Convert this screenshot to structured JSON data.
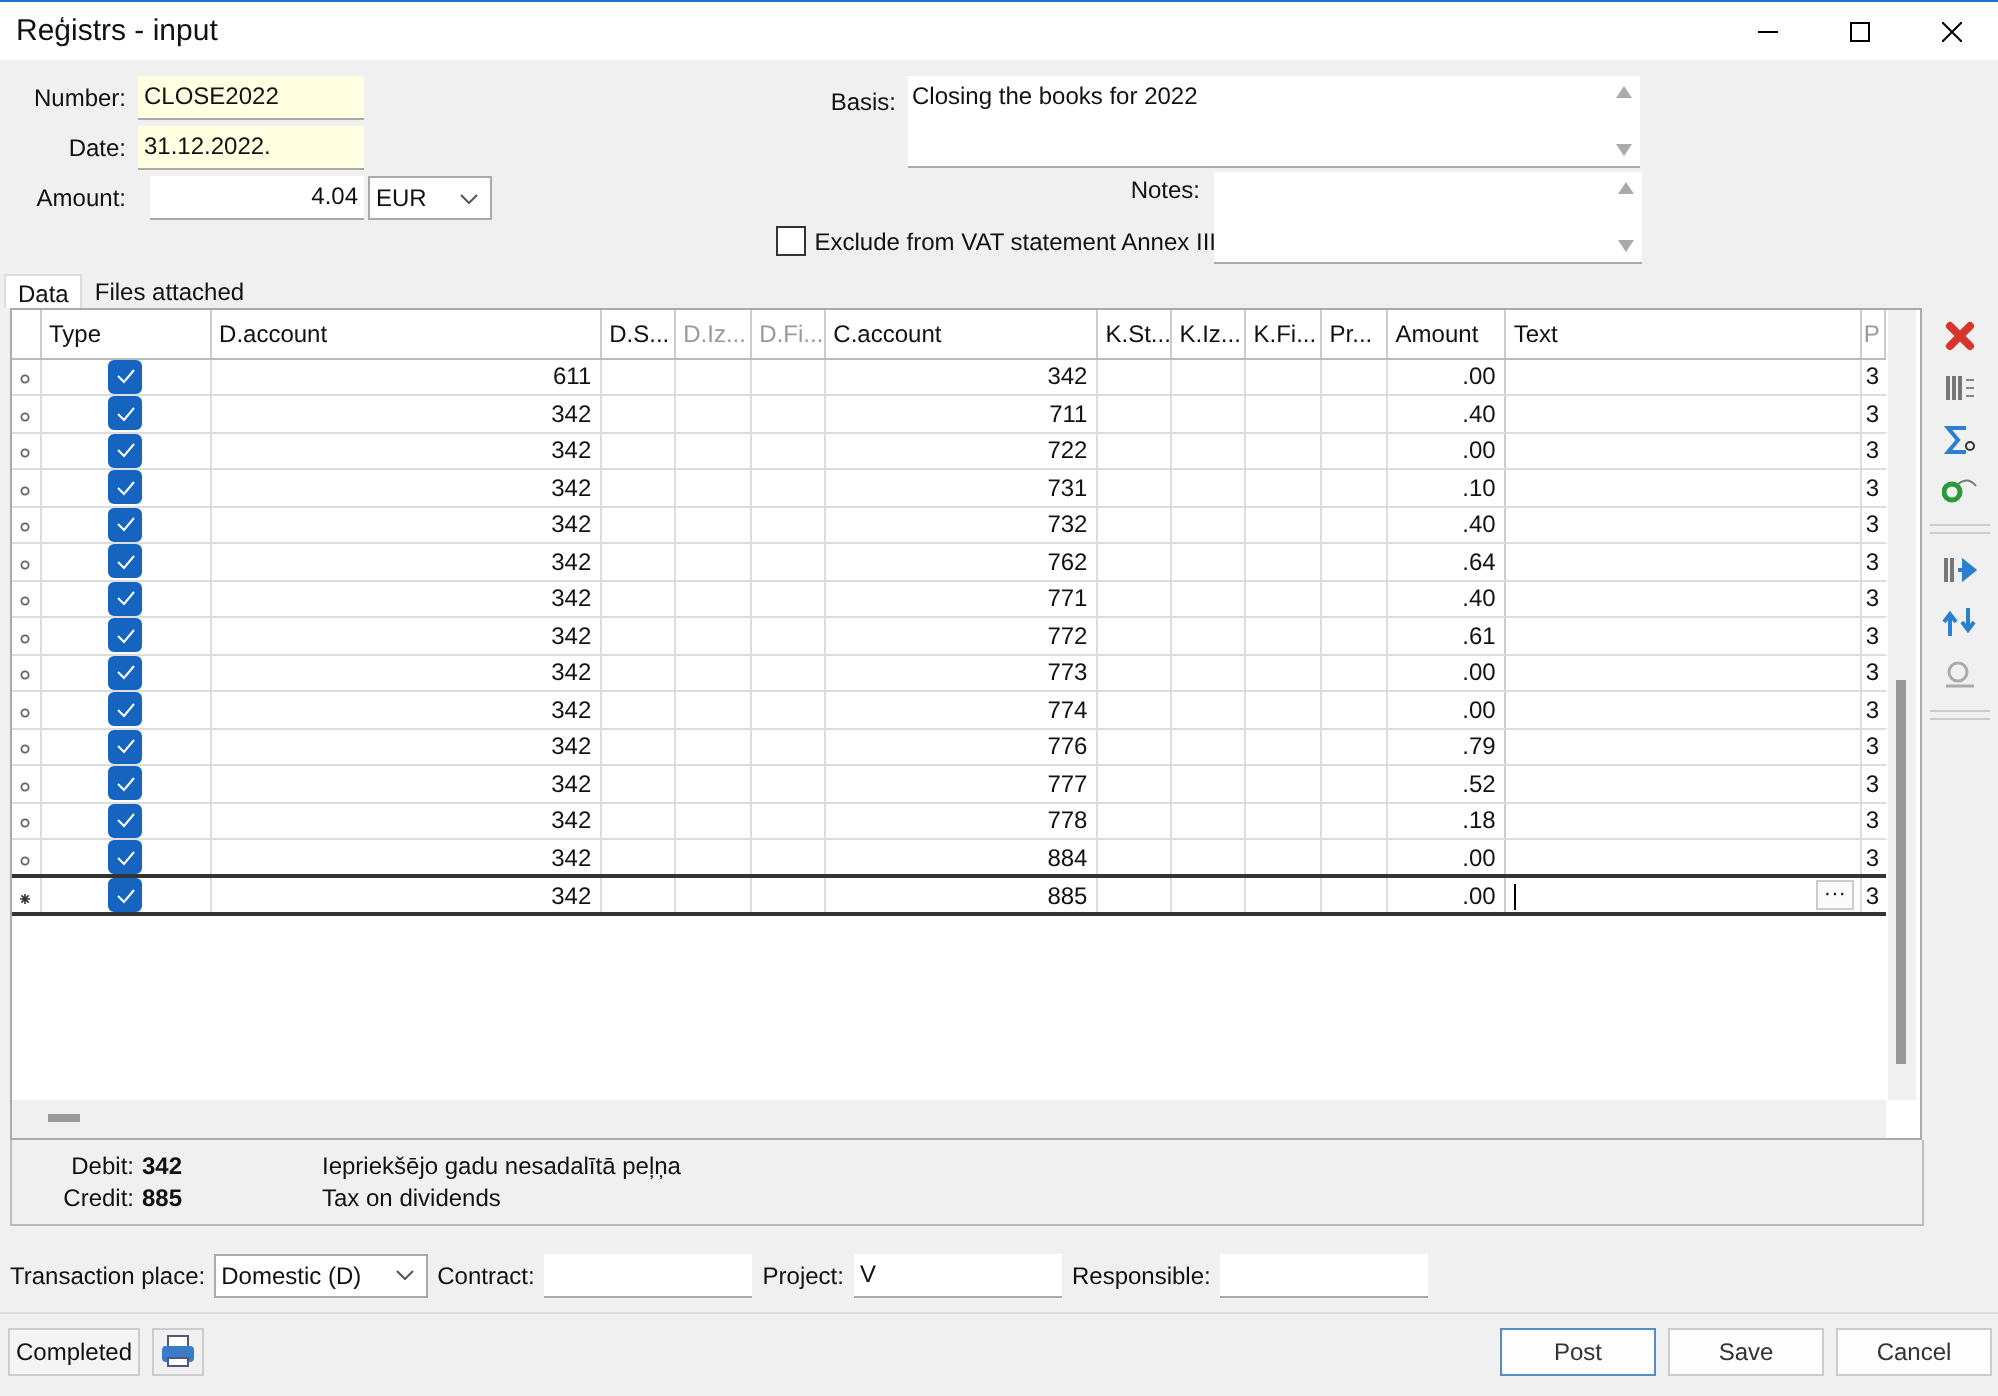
{
  "window": {
    "title": "Reģistrs - input"
  },
  "header": {
    "number_label": "Number:",
    "number": "CLOSE2022",
    "date_label": "Date:",
    "date": "31.12.2022.",
    "amount_label": "Amount:",
    "amount": "4.04",
    "currency": "EUR",
    "basis_label": "Basis:",
    "basis": "Closing the books for 2022",
    "notes_label": "Notes:",
    "exclude_vat": {
      "label": "Exclude from VAT statement Annex III",
      "checked": false
    }
  },
  "tabs": [
    {
      "label": "Data",
      "selected": true
    },
    {
      "label": "Files attached",
      "selected": false
    }
  ],
  "table": {
    "columns": [
      {
        "label": "Type",
        "disabled": false
      },
      {
        "label": "D.account",
        "disabled": false
      },
      {
        "label": "D.S...",
        "disabled": false
      },
      {
        "label": "D.Iz...",
        "disabled": true
      },
      {
        "label": "D.Fi...",
        "disabled": true
      },
      {
        "label": "C.account",
        "disabled": false
      },
      {
        "label": "K.St...",
        "disabled": false
      },
      {
        "label": "K.Iz...",
        "disabled": false
      },
      {
        "label": "K.Fi...",
        "disabled": false
      },
      {
        "label": "Pr...",
        "disabled": false
      },
      {
        "label": "Amount",
        "disabled": false
      },
      {
        "label": "Text",
        "disabled": false
      },
      {
        "label": "P",
        "disabled": true
      }
    ],
    "rows": [
      {
        "type_checked": true,
        "d_account": "611",
        "c_account": "342",
        "amount": ".00",
        "column_13": "3",
        "selected": false
      },
      {
        "type_checked": true,
        "d_account": "342",
        "c_account": "711",
        "amount": ".40",
        "column_13": "3",
        "selected": false
      },
      {
        "type_checked": true,
        "d_account": "342",
        "c_account": "722",
        "amount": ".00",
        "column_13": "3",
        "selected": false
      },
      {
        "type_checked": true,
        "d_account": "342",
        "c_account": "731",
        "amount": ".10",
        "column_13": "3",
        "selected": false
      },
      {
        "type_checked": true,
        "d_account": "342",
        "c_account": "732",
        "amount": ".40",
        "column_13": "3",
        "selected": false
      },
      {
        "type_checked": true,
        "d_account": "342",
        "c_account": "762",
        "amount": ".64",
        "column_13": "3",
        "selected": false
      },
      {
        "type_checked": true,
        "d_account": "342",
        "c_account": "771",
        "amount": ".40",
        "column_13": "3",
        "selected": false
      },
      {
        "type_checked": true,
        "d_account": "342",
        "c_account": "772",
        "amount": ".61",
        "column_13": "3",
        "selected": false
      },
      {
        "type_checked": true,
        "d_account": "342",
        "c_account": "773",
        "amount": ".00",
        "column_13": "3",
        "selected": false
      },
      {
        "type_checked": true,
        "d_account": "342",
        "c_account": "774",
        "amount": ".00",
        "column_13": "3",
        "selected": false
      },
      {
        "type_checked": true,
        "d_account": "342",
        "c_account": "776",
        "amount": ".79",
        "column_13": "3",
        "selected": false
      },
      {
        "type_checked": true,
        "d_account": "342",
        "c_account": "777",
        "amount": ".52",
        "column_13": "3",
        "selected": false
      },
      {
        "type_checked": true,
        "d_account": "342",
        "c_account": "778",
        "amount": ".18",
        "column_13": "3",
        "selected": false
      },
      {
        "type_checked": true,
        "d_account": "342",
        "c_account": "884",
        "amount": ".00",
        "column_13": "3",
        "selected": false
      },
      {
        "type_checked": true,
        "d_account": "342",
        "c_account": "885",
        "amount": ".00",
        "column_13": "3",
        "selected": true,
        "cell_button": "···"
      }
    ]
  },
  "account_info": {
    "debit_label": "Debit:",
    "debit": "342",
    "debit_name": "Iepriekšējo gadu nesadalītā peļņa",
    "credit_label": "Credit:",
    "credit": "885",
    "credit_name": "Tax on dividends"
  },
  "details": {
    "place_label": "Transaction place:",
    "place": "Domestic (D)",
    "contract_label": "Contract:",
    "project_label": "Project:",
    "project": "V",
    "responsible_label": "Responsible:"
  },
  "footer": {
    "status": "Completed",
    "buttons": [
      {
        "label": "Post",
        "default": true
      },
      {
        "label": "Save",
        "default": false
      },
      {
        "label": "Cancel",
        "default": false
      }
    ]
  }
}
